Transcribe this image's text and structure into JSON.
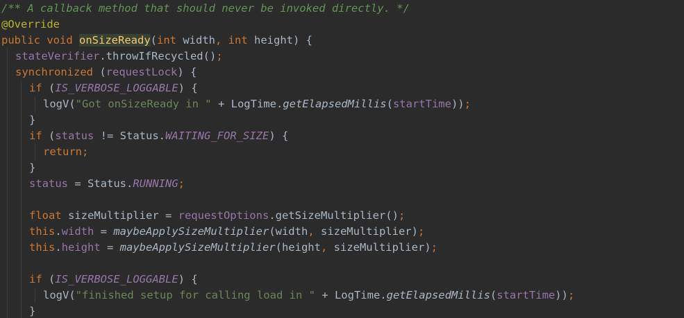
{
  "lines": [
    {
      "tokens": [
        {
          "t": "/** A callback method that should never be invoked directly. */",
          "c": "comment"
        }
      ]
    },
    {
      "tokens": [
        {
          "t": "@Override",
          "c": "annotation"
        }
      ]
    },
    {
      "tokens": [
        {
          "t": "public ",
          "c": "keyword"
        },
        {
          "t": "void ",
          "c": "keyword"
        },
        {
          "t": "onSizeReady",
          "c": "method"
        },
        {
          "t": "(",
          "c": "plain"
        },
        {
          "t": "int ",
          "c": "keyword"
        },
        {
          "t": "width",
          "c": "plain"
        },
        {
          "t": ", ",
          "c": "punct"
        },
        {
          "t": "int ",
          "c": "keyword"
        },
        {
          "t": "height",
          "c": "plain"
        },
        {
          "t": ") {",
          "c": "plain"
        }
      ]
    },
    {
      "indent": 1,
      "tokens": [
        {
          "t": "stateVerifier",
          "c": "field"
        },
        {
          "t": ".throwIfRecycled()",
          "c": "plain"
        },
        {
          "t": ";",
          "c": "punct"
        }
      ]
    },
    {
      "indent": 1,
      "tokens": [
        {
          "t": "synchronized ",
          "c": "keyword"
        },
        {
          "t": "(",
          "c": "plain"
        },
        {
          "t": "requestLock",
          "c": "field"
        },
        {
          "t": ") {",
          "c": "plain"
        }
      ]
    },
    {
      "indent": 2,
      "tokens": [
        {
          "t": "if ",
          "c": "keyword"
        },
        {
          "t": "(",
          "c": "plain"
        },
        {
          "t": "IS_VERBOSE_LOGGABLE",
          "c": "static"
        },
        {
          "t": ") {",
          "c": "plain"
        }
      ]
    },
    {
      "indent": 3,
      "tokens": [
        {
          "t": "logV(",
          "c": "plain"
        },
        {
          "t": "\"Got onSizeReady in \"",
          "c": "string"
        },
        {
          "t": " + LogTime.",
          "c": "plain"
        },
        {
          "t": "getElapsedMillis",
          "c": "italic"
        },
        {
          "t": "(",
          "c": "plain"
        },
        {
          "t": "startTime",
          "c": "field"
        },
        {
          "t": "))",
          "c": "plain"
        },
        {
          "t": ";",
          "c": "punct"
        }
      ]
    },
    {
      "indent": 2,
      "tokens": [
        {
          "t": "}",
          "c": "plain"
        }
      ]
    },
    {
      "indent": 2,
      "tokens": [
        {
          "t": "if ",
          "c": "keyword"
        },
        {
          "t": "(",
          "c": "plain"
        },
        {
          "t": "status",
          "c": "field"
        },
        {
          "t": " != Status.",
          "c": "plain"
        },
        {
          "t": "WAITING_FOR_SIZE",
          "c": "static"
        },
        {
          "t": ") {",
          "c": "plain"
        }
      ]
    },
    {
      "indent": 3,
      "tokens": [
        {
          "t": "return",
          "c": "keyword"
        },
        {
          "t": ";",
          "c": "punct"
        }
      ]
    },
    {
      "indent": 2,
      "tokens": [
        {
          "t": "}",
          "c": "plain"
        }
      ]
    },
    {
      "indent": 2,
      "tokens": [
        {
          "t": "status",
          "c": "field"
        },
        {
          "t": " = Status.",
          "c": "plain"
        },
        {
          "t": "RUNNING",
          "c": "static"
        },
        {
          "t": ";",
          "c": "punct"
        }
      ]
    },
    {
      "tokens": []
    },
    {
      "indent": 2,
      "tokens": [
        {
          "t": "float ",
          "c": "keyword"
        },
        {
          "t": "sizeMultiplier = ",
          "c": "plain"
        },
        {
          "t": "requestOptions",
          "c": "field"
        },
        {
          "t": ".getSizeMultiplier()",
          "c": "plain"
        },
        {
          "t": ";",
          "c": "punct"
        }
      ]
    },
    {
      "indent": 2,
      "tokens": [
        {
          "t": "this",
          "c": "keyword"
        },
        {
          "t": ".",
          "c": "plain"
        },
        {
          "t": "width",
          "c": "field"
        },
        {
          "t": " = ",
          "c": "plain"
        },
        {
          "t": "maybeApplySizeMultiplier",
          "c": "italic"
        },
        {
          "t": "(width",
          "c": "plain"
        },
        {
          "t": ", ",
          "c": "punct"
        },
        {
          "t": "sizeMultiplier)",
          "c": "plain"
        },
        {
          "t": ";",
          "c": "punct"
        }
      ]
    },
    {
      "indent": 2,
      "tokens": [
        {
          "t": "this",
          "c": "keyword"
        },
        {
          "t": ".",
          "c": "plain"
        },
        {
          "t": "height",
          "c": "field"
        },
        {
          "t": " = ",
          "c": "plain"
        },
        {
          "t": "maybeApplySizeMultiplier",
          "c": "italic"
        },
        {
          "t": "(height",
          "c": "plain"
        },
        {
          "t": ", ",
          "c": "punct"
        },
        {
          "t": "sizeMultiplier)",
          "c": "plain"
        },
        {
          "t": ";",
          "c": "punct"
        }
      ]
    },
    {
      "tokens": []
    },
    {
      "indent": 2,
      "tokens": [
        {
          "t": "if ",
          "c": "keyword"
        },
        {
          "t": "(",
          "c": "plain"
        },
        {
          "t": "IS_VERBOSE_LOGGABLE",
          "c": "static"
        },
        {
          "t": ") {",
          "c": "plain"
        }
      ]
    },
    {
      "indent": 3,
      "tokens": [
        {
          "t": "logV(",
          "c": "plain"
        },
        {
          "t": "\"finished setup for calling load in \"",
          "c": "string"
        },
        {
          "t": " + LogTime.",
          "c": "plain"
        },
        {
          "t": "getElapsedMillis",
          "c": "italic"
        },
        {
          "t": "(",
          "c": "plain"
        },
        {
          "t": "startTime",
          "c": "field"
        },
        {
          "t": "))",
          "c": "plain"
        },
        {
          "t": ";",
          "c": "punct"
        }
      ]
    },
    {
      "indent": 2,
      "tokens": [
        {
          "t": "}",
          "c": "plain"
        }
      ]
    }
  ],
  "colors": {
    "background": "#2b2b2b",
    "comment": "#629755",
    "annotation": "#bbb529",
    "keyword": "#cc7832",
    "method": "#ffc66d",
    "field": "#9876aa",
    "string": "#6a8759",
    "plain": "#a9b7c6"
  }
}
